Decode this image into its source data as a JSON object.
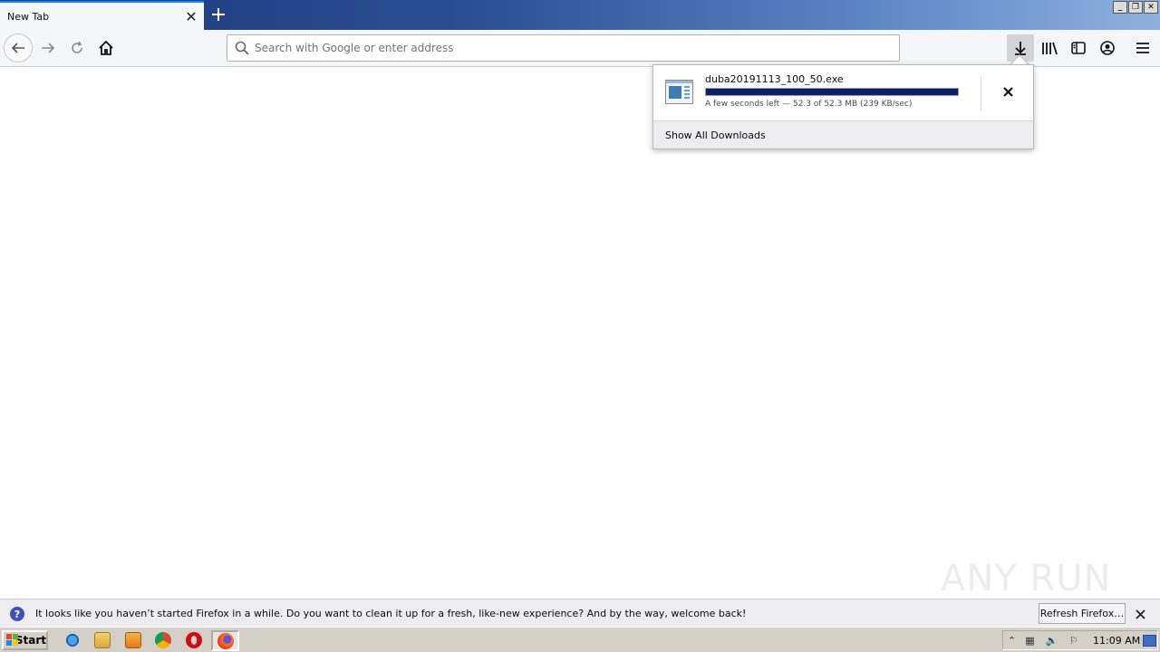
{
  "tab": {
    "title": "New Tab"
  },
  "urlbar": {
    "placeholder": "Search with Google or enter address"
  },
  "downloads": {
    "filename": "duba20191113_100_50.exe",
    "progress_percent": 100,
    "status": "A few seconds left — 52.3 of 52.3 MB (239 KB/sec)",
    "show_all_label": "Show All Downloads"
  },
  "watermark": {
    "text": "ANY RUN"
  },
  "notification": {
    "text": "It looks like you haven’t started Firefox in a while. Do you want to clean it up for a fresh, like-new experience? And by the way, welcome back!",
    "button_label": "Refresh Firefox…"
  },
  "taskbar": {
    "start_label": "Start",
    "clock": "11:09 AM"
  },
  "colors": {
    "progress_fill": "#0b1f6b",
    "tab_accent": "#0a84ff"
  }
}
